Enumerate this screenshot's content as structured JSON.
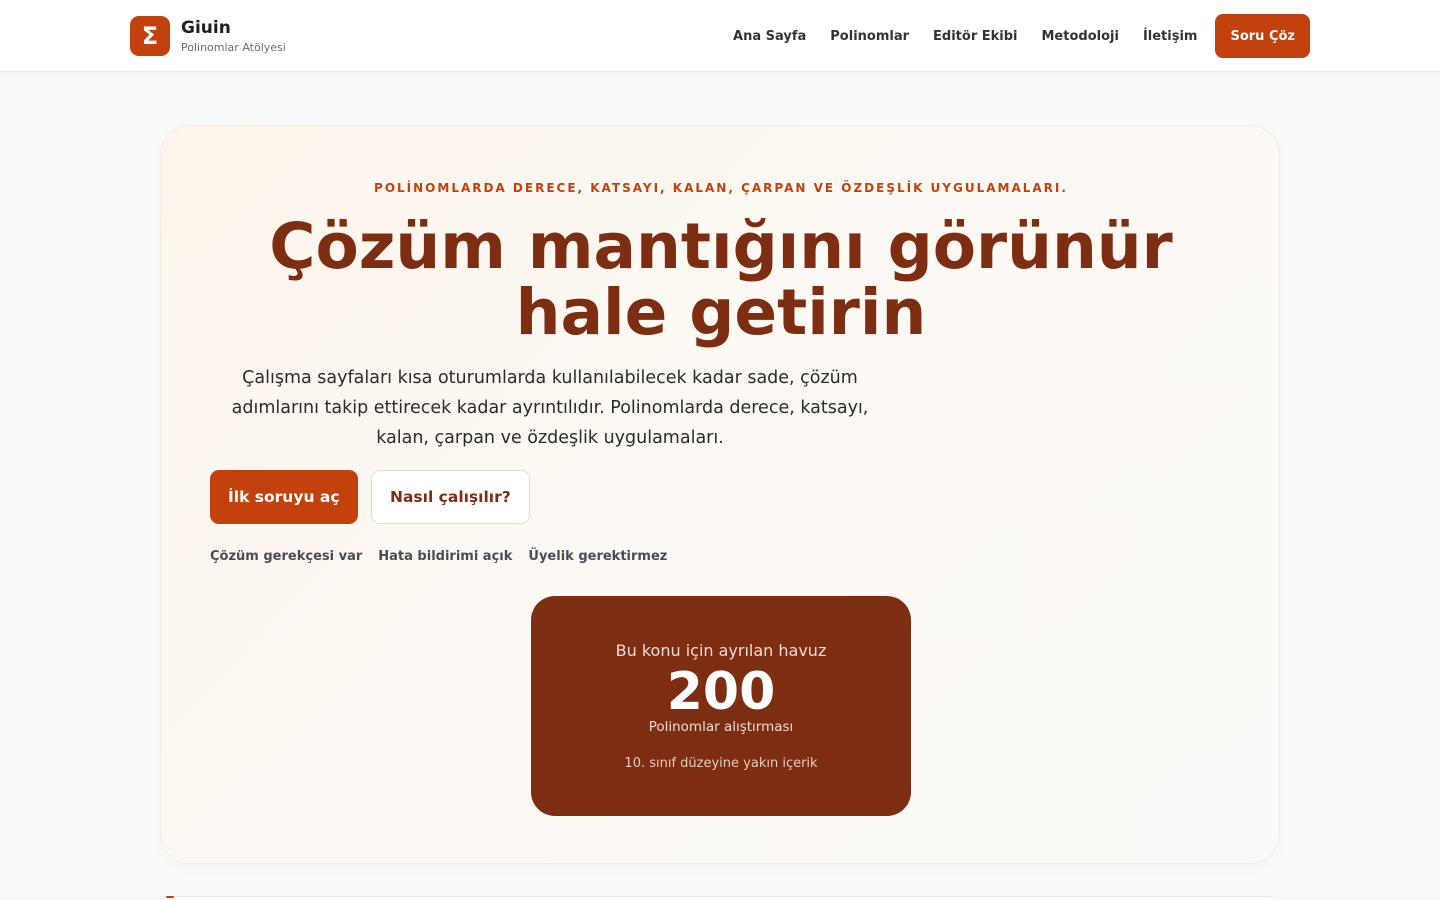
{
  "header": {
    "logo_glyph": "Σ",
    "brand_name": "Giuin",
    "brand_subtitle": "Polinomlar Atölyesi",
    "nav": [
      "Ana Sayfa",
      "Polinomlar",
      "Editör Ekibi",
      "Metodoloji",
      "İletişim"
    ],
    "cta_label": "Soru Çöz"
  },
  "hero": {
    "eyebrow": "POLİNOMLARDA DERECE, KATSAYI, KALAN, ÇARPAN VE ÖZDEŞLİK UYGULAMALARI.",
    "title": "Çözüm mantığını görünür hale getirin",
    "lead": "Çalışma sayfaları kısa oturumlarda kullanılabilecek kadar sade, çözüm adımlarını takip ettirecek kadar ayrıntılıdır. Polinomlarda derece, katsayı, kalan, çarpan ve özdeşlik uygulamaları.",
    "primary_button": "İlk soruyu aç",
    "secondary_button": "Nasıl çalışılır?",
    "badges": [
      "Çözüm gerekçesi var",
      "Hata bildirimi açık",
      "Üyelik gerektirmez"
    ]
  },
  "stat_card": {
    "label": "Bu konu için ayrılan havuz",
    "value": "200",
    "unit": "Polinomlar alıştırması",
    "note": "10. sınıf düzeyine yakın içerik"
  },
  "colors": {
    "accent": "#c2410c",
    "accent_dark": "#7c2d12"
  }
}
